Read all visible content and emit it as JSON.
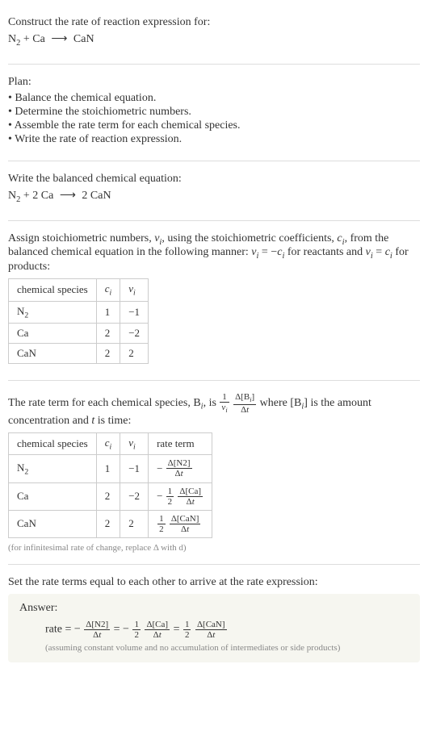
{
  "intro": {
    "heading": "Construct the rate of reaction expression for:",
    "equation_lhs_a": "N",
    "equation_lhs_a_sub": "2",
    "plus1": " + ",
    "equation_lhs_b": "Ca",
    "arrow": "⟶",
    "equation_rhs": "CaN"
  },
  "plan": {
    "heading": "Plan:",
    "items": [
      "• Balance the chemical equation.",
      "• Determine the stoichiometric numbers.",
      "• Assemble the rate term for each chemical species.",
      "• Write the rate of reaction expression."
    ]
  },
  "balanced": {
    "heading": "Write the balanced chemical equation:",
    "lhs_a": "N",
    "lhs_a_sub": "2",
    "plus": " + 2 Ca ",
    "arrow": "⟶",
    "rhs": " 2 CaN"
  },
  "assign": {
    "text_a": "Assign stoichiometric numbers, ",
    "nu_i": "ν",
    "i": "i",
    "text_b": ", using the stoichiometric coefficients, ",
    "c_i": "c",
    "text_c": ", from the balanced chemical equation in the following manner: ",
    "rel1_lhs": "ν",
    "rel1_eq": " = −",
    "rel1_rhs": "c",
    "text_d": " for reactants and ",
    "rel2_lhs": "ν",
    "rel2_eq": " = ",
    "rel2_rhs": "c",
    "text_e": " for products:"
  },
  "table1": {
    "headers": {
      "species": "chemical species",
      "c": "c",
      "c_sub": "i",
      "nu": "ν",
      "nu_sub": "i"
    },
    "rows": [
      {
        "species_a": "N",
        "species_sub": "2",
        "c": "1",
        "nu": "−1"
      },
      {
        "species_a": "Ca",
        "species_sub": "",
        "c": "2",
        "nu": "−2"
      },
      {
        "species_a": "CaN",
        "species_sub": "",
        "c": "2",
        "nu": "2"
      }
    ]
  },
  "rateterm": {
    "text_a": "The rate term for each chemical species, B",
    "text_b": ", is ",
    "one": "1",
    "nu": "ν",
    "dB": "Δ[B",
    "dB_close": "]",
    "dt": "Δt",
    "text_c": " where [B",
    "text_d": "] is the amount concentration and ",
    "t": "t",
    "text_e": " is time:"
  },
  "table2": {
    "headers": {
      "species": "chemical species",
      "c": "c",
      "c_sub": "i",
      "nu": "ν",
      "nu_sub": "i",
      "rate": "rate term"
    },
    "rows": [
      {
        "species_a": "N",
        "species_sub": "2",
        "c": "1",
        "nu": "−1",
        "neg": "−",
        "fnum": "",
        "fden": "",
        "dnum": "Δ[N2]",
        "dden": "Δt"
      },
      {
        "species_a": "Ca",
        "species_sub": "",
        "c": "2",
        "nu": "−2",
        "neg": "−",
        "fnum": "1",
        "fden": "2",
        "dnum": "Δ[Ca]",
        "dden": "Δt"
      },
      {
        "species_a": "CaN",
        "species_sub": "",
        "c": "2",
        "nu": "2",
        "neg": "",
        "fnum": "1",
        "fden": "2",
        "dnum": "Δ[CaN]",
        "dden": "Δt"
      }
    ],
    "note": "(for infinitesimal rate of change, replace Δ with d)"
  },
  "final": {
    "heading": "Set the rate terms equal to each other to arrive at the rate expression:"
  },
  "answer": {
    "label": "Answer:",
    "rate_word": "rate = ",
    "t1_neg": "−",
    "t1_dnum": "Δ[N2]",
    "t1_dden": "Δt",
    "eq": " = ",
    "t2_neg": "−",
    "t2_fnum": "1",
    "t2_fden": "2",
    "t2_dnum": "Δ[Ca]",
    "t2_dden": "Δt",
    "t3_fnum": "1",
    "t3_fden": "2",
    "t3_dnum": "Δ[CaN]",
    "t3_dden": "Δt",
    "note": "(assuming constant volume and no accumulation of intermediates or side products)"
  }
}
